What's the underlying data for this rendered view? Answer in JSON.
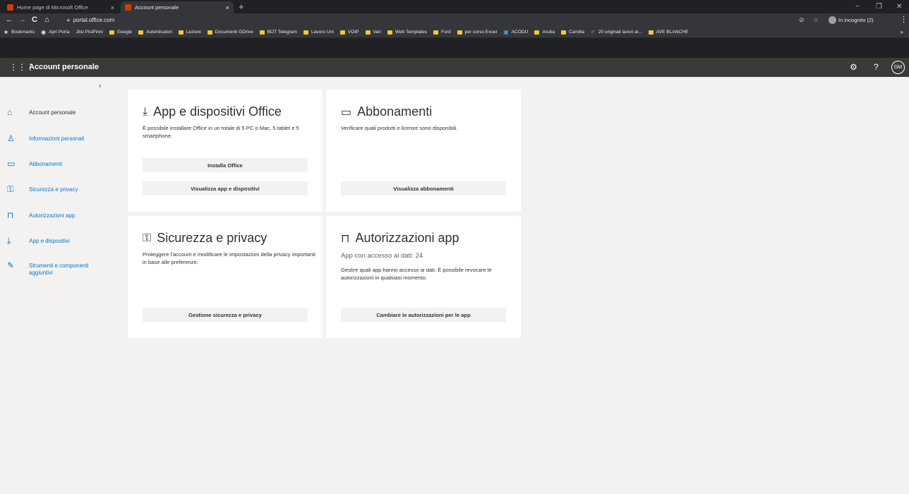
{
  "browser": {
    "tabs": [
      {
        "label": "Home page di Microsoft Office",
        "close": "×"
      },
      {
        "label": "Account personale",
        "close": "×"
      }
    ],
    "new_tab": "+",
    "window_controls": {
      "minimize": "−",
      "restore": "❐",
      "close": "✕"
    },
    "nav": {
      "back": "←",
      "forward": "→",
      "reload": "C",
      "home": "⌂"
    },
    "url": "portal.office.com",
    "incognito_label": "In incognito (2)",
    "menu": "⋮",
    "bookmarks_more": "»",
    "bookmarks": [
      {
        "label": "Bookmarks",
        "icon": "star"
      },
      {
        "label": "Apri Porta",
        "icon": "globe"
      },
      {
        "label": "Jitsi PisiPinni",
        "icon": "none"
      },
      {
        "label": "Google",
        "icon": "folder"
      },
      {
        "label": "Autenticatori",
        "icon": "folder"
      },
      {
        "label": "Lezioni",
        "icon": "folder"
      },
      {
        "label": "Documenti GDrive",
        "icon": "folder"
      },
      {
        "label": "BOT Telegram",
        "icon": "folder"
      },
      {
        "label": "Lavoro Uni",
        "icon": "folder"
      },
      {
        "label": "VOIP",
        "icon": "folder"
      },
      {
        "label": "Vari",
        "icon": "folder"
      },
      {
        "label": "Web Templates",
        "icon": "folder"
      },
      {
        "label": "Ford",
        "icon": "folder"
      },
      {
        "label": "per corso Excel",
        "icon": "folder"
      },
      {
        "label": "ACODU",
        "icon": "app"
      },
      {
        "label": "Aruba",
        "icon": "folder"
      },
      {
        "label": "Camilla",
        "icon": "folder"
      },
      {
        "label": "20 originali lavori al...",
        "icon": "pin"
      },
      {
        "label": "AVE BLANCHE",
        "icon": "folder"
      }
    ]
  },
  "app": {
    "title": "Account personale",
    "waffle": "⋮⋮⋮",
    "settings_icon": "⚙",
    "help_icon": "?",
    "avatar_initials": "GM"
  },
  "sidebar": {
    "collapse": "‹",
    "items": [
      {
        "label": "Account personale",
        "icon": "⌂"
      },
      {
        "label": "Informazioni personali",
        "icon": "♙"
      },
      {
        "label": "Abbonamenti",
        "icon": "▭"
      },
      {
        "label": "Sicurezza e privacy",
        "icon": "⚿"
      },
      {
        "label": "Autorizzazioni app",
        "icon": "⊓"
      },
      {
        "label": "App e dispositivi",
        "icon": "⤓"
      },
      {
        "label": "Strumenti e componenti aggiuntivi",
        "icon": "✎"
      }
    ]
  },
  "cards": {
    "apps": {
      "title": "App e dispositivi Office",
      "icon": "⤓",
      "desc": "È possibile installare Office in un totale di 5 PC o Mac, 5 tablet e 5 smartphone.",
      "button1": "Installa Office",
      "button2": "Visualizza app e dispositivi"
    },
    "subscriptions": {
      "title": "Abbonamenti",
      "icon": "▭",
      "desc": "Verificare quali prodotti e licenze sono disponibili.",
      "button": "Visualizza abbonamenti"
    },
    "security": {
      "title": "Sicurezza e privacy",
      "icon": "⚿",
      "desc": "Proteggere l'account e modificare le impostazioni della privacy importanti in base alle preferenze.",
      "button": "Gestione sicurezza e privacy"
    },
    "permissions": {
      "title": "Autorizzazioni app",
      "icon": "⊓",
      "sub": "App con accesso ai dati: 24",
      "desc": "Gestire quali app hanno accesso ai dati. È possibile revocare le autorizzazioni in qualsiasi momento.",
      "button": "Cambiare le autorizzazioni per le app"
    }
  }
}
